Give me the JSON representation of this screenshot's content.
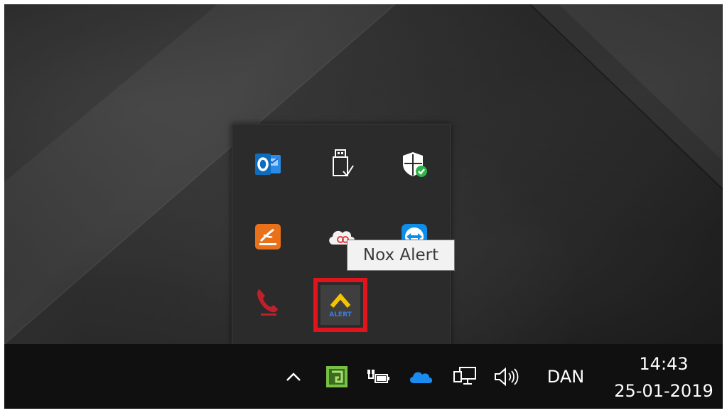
{
  "tooltip": {
    "text": "Nox Alert"
  },
  "tray": {
    "icons": [
      {
        "name": "outlook-icon",
        "color": "#0f6cbd"
      },
      {
        "name": "usb-eject-icon",
        "color": "#ffffff"
      },
      {
        "name": "windows-security-icon",
        "color": "#2db34a"
      },
      {
        "name": "office-upload-icon",
        "color": "#e8711a"
      },
      {
        "name": "creative-cloud-icon",
        "color": "#f2f2f2"
      },
      {
        "name": "teamviewer-icon",
        "color": "#0e8ee9"
      },
      {
        "name": "phone-icon",
        "color": "#c0202a"
      },
      {
        "name": "nox-alert-icon",
        "color": "#f5c400"
      }
    ],
    "nox_sublabel": "ALERT"
  },
  "taskbar": {
    "language": "DAN",
    "time": "14:43",
    "date": "25-01-2019",
    "icons": [
      "show-hidden-icons-chevron",
      "green-app-icon",
      "battery-plug-icon",
      "onedrive-icon",
      "network-icon",
      "volume-icon"
    ]
  }
}
